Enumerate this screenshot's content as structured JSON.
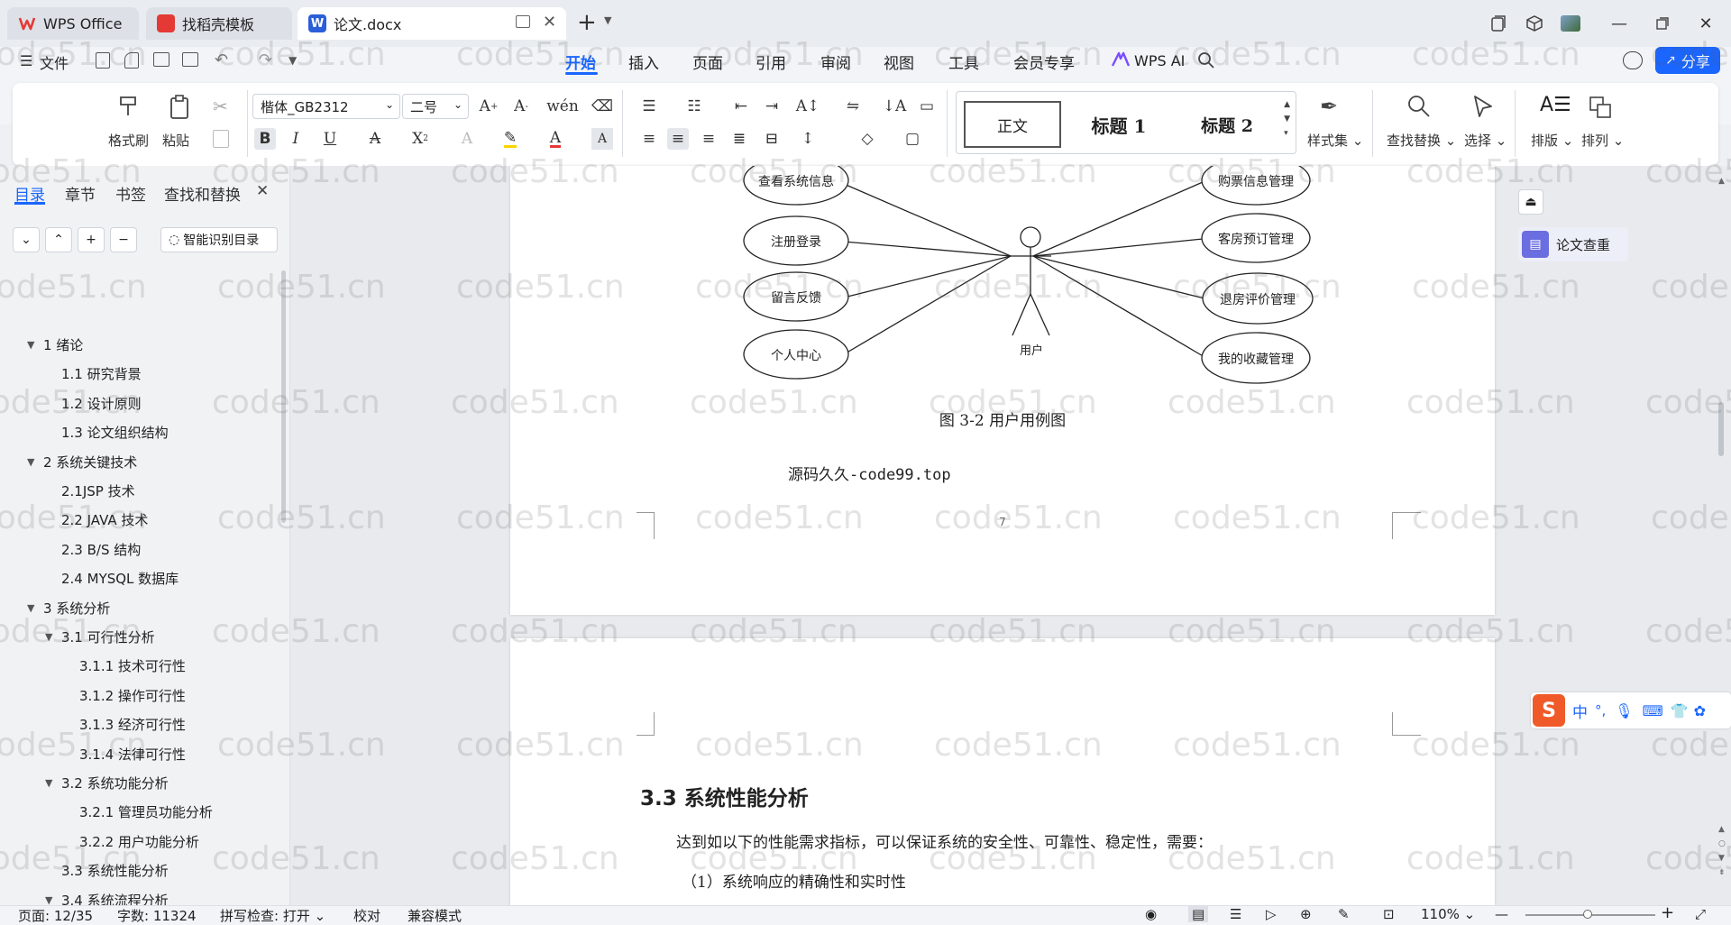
{
  "titlebar": {
    "tabs": [
      {
        "label": "WPS Office",
        "icon": "wps-logo-icon"
      },
      {
        "label": "找稻壳模板",
        "icon": "docer-icon"
      },
      {
        "label": "论文.docx",
        "icon": "word-doc-icon"
      }
    ]
  },
  "menubar": {
    "file_label": "文件",
    "items": [
      "开始",
      "插入",
      "页面",
      "引用",
      "审阅",
      "视图",
      "工具",
      "会员专享"
    ],
    "active": "开始",
    "ai_label": "WPS AI",
    "share_label": "分享"
  },
  "ribbon": {
    "format_painter": "格式刷",
    "paste": "粘贴",
    "font_name": "楷体_GB2312",
    "font_size": "二号",
    "styles": [
      "正文",
      "标题 1",
      "标题 2"
    ],
    "style_set": "样式集",
    "find_replace": "查找替换",
    "select": "选择",
    "layout": "排版",
    "arrange": "排列"
  },
  "leftpanel": {
    "tabs": [
      "目录",
      "章节",
      "书签",
      "查找和替换"
    ],
    "smart_toc": "智能识别目录",
    "toc": [
      {
        "label": "1 绪论",
        "level": 1,
        "expanded": true
      },
      {
        "label": "1.1 研究背景",
        "level": 2
      },
      {
        "label": "1.2 设计原则",
        "level": 2
      },
      {
        "label": "1.3 论文组织结构",
        "level": 2
      },
      {
        "label": "2 系统关键技术",
        "level": 1,
        "expanded": true
      },
      {
        "label": "2.1JSP 技术",
        "level": 2
      },
      {
        "label": "2.2 JAVA 技术",
        "level": 2
      },
      {
        "label": "2.3 B/S 结构",
        "level": 2
      },
      {
        "label": "2.4 MYSQL 数据库",
        "level": 2
      },
      {
        "label": "3 系统分析",
        "level": 1,
        "expanded": true
      },
      {
        "label": "3.1 可行性分析",
        "level": 2,
        "expanded": true
      },
      {
        "label": "3.1.1 技术可行性",
        "level": 3
      },
      {
        "label": "3.1.2 操作可行性",
        "level": 3
      },
      {
        "label": "3.1.3 经济可行性",
        "level": 3
      },
      {
        "label": "3.1.4 法律可行性",
        "level": 3
      },
      {
        "label": "3.2 系统功能分析",
        "level": 2,
        "expanded": true
      },
      {
        "label": "3.2.1 管理员功能分析",
        "level": 3
      },
      {
        "label": "3.2.2 用户功能分析",
        "level": 3
      },
      {
        "label": "3.3 系统性能分析",
        "level": 2
      },
      {
        "label": "3.4 系统流程分析",
        "level": 2,
        "expanded": true
      }
    ]
  },
  "document": {
    "usecase": {
      "left": [
        "查看系统信息",
        "注册登录",
        "留言反馈",
        "个人中心"
      ],
      "right": [
        "购票信息管理",
        "客房预订管理",
        "退房评价管理",
        "我的收藏管理"
      ],
      "actor": "用户"
    },
    "figure_caption": "图 3-2   用户用例图",
    "source_note": "源码久久-code99.top",
    "page_number": "7",
    "heading": "3.3 系统性能分析",
    "para1": "达到如以下的性能需求指标，可以保证系统的安全性、可靠性、稳定性，需要：",
    "para2": "（1）系统响应的精确性和实时性"
  },
  "rightpanel": {
    "plagiarism_check": "论文查重"
  },
  "ime": {
    "mode": "中",
    "punct": "°,"
  },
  "watermark": "code51.cn",
  "statusbar": {
    "page": "页面: 12/35",
    "words": "字数: 11324",
    "spell": "拼写检查: 打开",
    "proof": "校对",
    "compat": "兼容模式",
    "zoom": "110%"
  },
  "colors": {
    "accent": "#1a66ff",
    "wps_red": "#e53935",
    "word_blue": "#2b5fd9"
  }
}
